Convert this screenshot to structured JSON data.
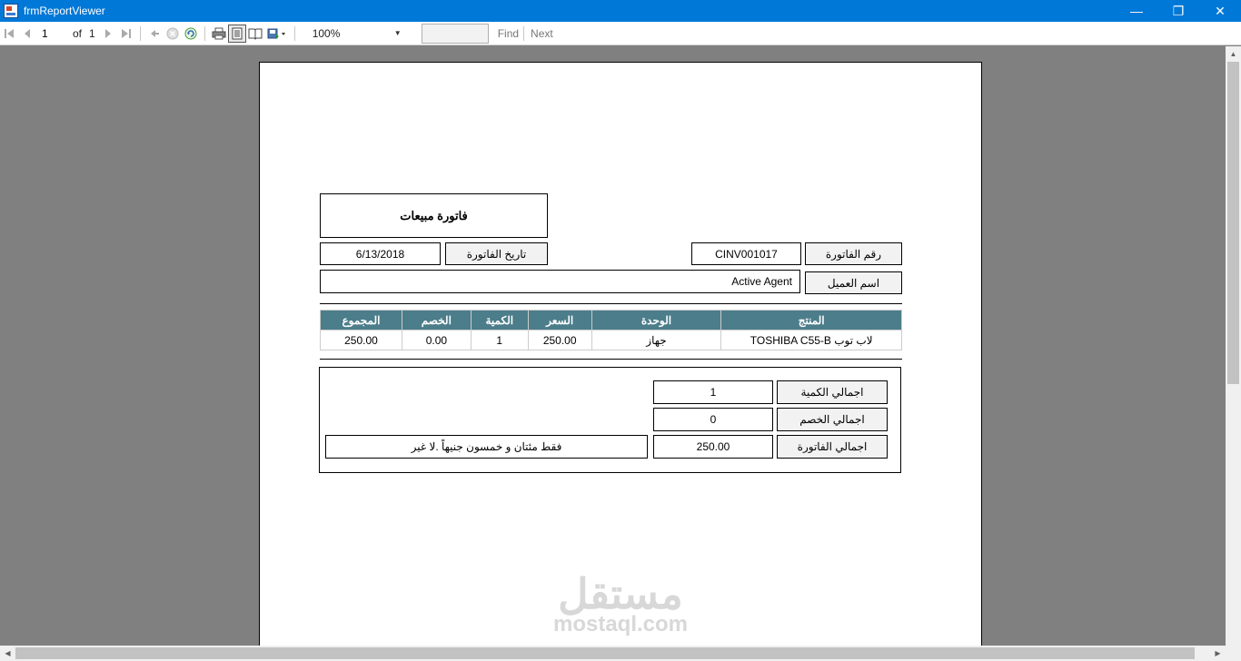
{
  "window": {
    "title": "frmReportViewer",
    "minimize": "—",
    "restore": "❐",
    "close": "✕"
  },
  "toolbar": {
    "page_number": "1",
    "of_label": "of",
    "total_pages": "1",
    "zoom": "100%",
    "find_label": "Find",
    "next_label": "Next",
    "find_placeholder": ""
  },
  "invoice": {
    "title": "فاتورة مبيعات",
    "invoice_number_label": "رقم الفاتورة",
    "invoice_number": "CINV001017",
    "invoice_date_label": "تاريخ الفاتورة",
    "invoice_date": "6/13/2018",
    "customer_label": "اسم العميل",
    "customer_name": "Active Agent",
    "columns": [
      "المنتج",
      "الوحدة",
      "السعر",
      "الكمية",
      "الخصم",
      "المجموع"
    ],
    "rows": [
      [
        "لاب توب TOSHIBA C55-B",
        "جهاز",
        "250.00",
        "1",
        "0.00",
        "250.00"
      ]
    ],
    "total_qty_label": "اجمالي الكمية",
    "total_qty": "1",
    "total_discount_label": "اجمالي الخصم",
    "total_discount": "0",
    "total_invoice_label": "اجمالي الفاتورة",
    "total_invoice": "250.00",
    "amount_in_words": "فقط مئتان و خمسون جنيهاً .لا غير"
  },
  "watermark": {
    "arabic": "مستقل",
    "latin": "mostaql.com"
  },
  "colors": {
    "titlebar": "#0078d7",
    "table_header": "#4c7d8a",
    "viewer_background": "#808080"
  }
}
